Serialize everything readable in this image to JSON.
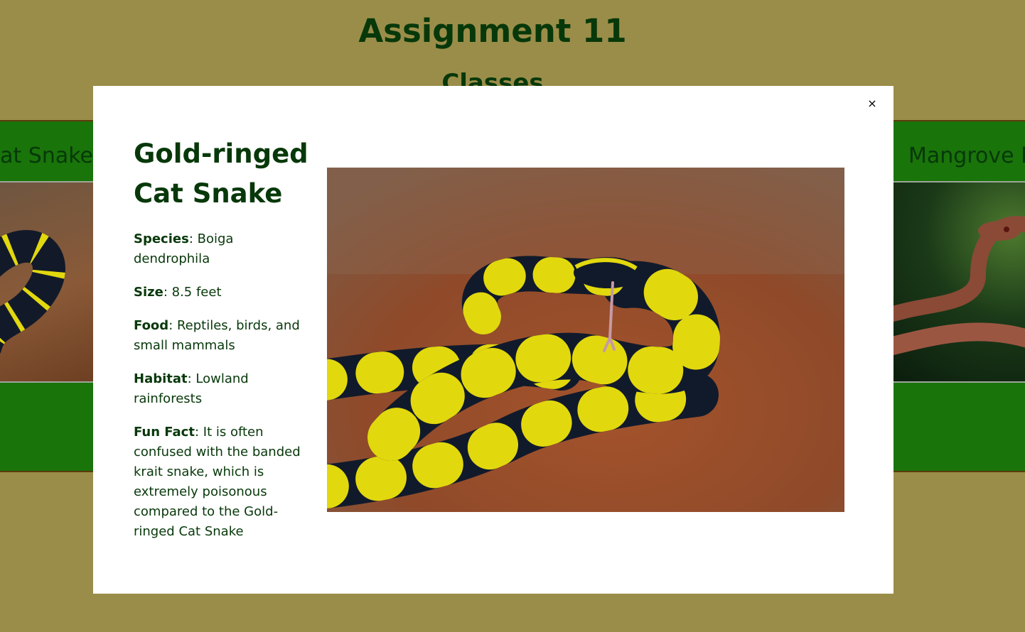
{
  "page": {
    "title": "Assignment 11",
    "subtitle": "Classes"
  },
  "cards": {
    "left_title": "Cat Snake",
    "right_title": "Mangrove P"
  },
  "modal": {
    "close_label": "×",
    "name": "Gold-ringed Cat Snake",
    "facts": [
      {
        "label": "Species",
        "value": ": Boiga dendrophila"
      },
      {
        "label": "Size",
        "value": ": 8.5 feet"
      },
      {
        "label": "Food",
        "value": ": Reptiles, birds, and small mammals"
      },
      {
        "label": "Habitat",
        "value": ": Lowland rainforests"
      },
      {
        "label": "Fun Fact",
        "value": ": It is often confused with the banded krait snake, which is extremely poisonous compared to the Gold-ringed Cat Snake"
      }
    ]
  },
  "colors": {
    "background": "#9a8d49",
    "heading": "#07380a",
    "band": "#19740a",
    "modal": "#ffffff",
    "snake_black": "#111a2b",
    "snake_yellow": "#e2d80e"
  },
  "icons": {
    "close": "close-icon"
  }
}
